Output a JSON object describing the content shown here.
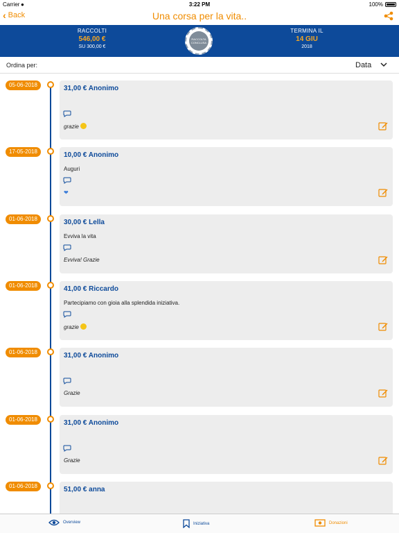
{
  "status": {
    "carrier": "Carrier",
    "time": "3:22 PM",
    "battery": "100%"
  },
  "nav": {
    "back_label": "Back",
    "title": "Una corsa per la vita.."
  },
  "header": {
    "raised_label": "RACCOLTI",
    "raised_value": "546,00 €",
    "goal_text": "SU 300,00 €",
    "badge_text": "RACCOLTA CONCLUSA",
    "ends_label": "TERMINA IL",
    "ends_value": "14 GIU",
    "ends_year": "2018"
  },
  "sort": {
    "label": "Ordina per:",
    "value": "Data"
  },
  "entries": [
    {
      "date": "05-06-2018",
      "amount": "31,00 € Anonimo",
      "message": "",
      "reply": "grazie",
      "emoji": "smile"
    },
    {
      "date": "17-05-2018",
      "amount": "10,00 € Anonimo",
      "message": "Auguri",
      "reply": "",
      "emoji": "heart"
    },
    {
      "date": "01-06-2018",
      "amount": "30,00 € Lella",
      "message": "Evviva la vita",
      "reply": "Evviva! Grazie",
      "emoji": ""
    },
    {
      "date": "01-06-2018",
      "amount": "41,00 € Riccardo",
      "message": "Partecipiamo con gioia alla splendida iniziativa.",
      "reply": "grazie",
      "emoji": "smile"
    },
    {
      "date": "01-06-2018",
      "amount": "31,00 € Anonimo",
      "message": "",
      "reply": "Grazie",
      "emoji": ""
    },
    {
      "date": "01-06-2018",
      "amount": "31,00 € Anonimo",
      "message": "",
      "reply": "Grazie",
      "emoji": ""
    },
    {
      "date": "01-06-2018",
      "amount": "51,00 € anna",
      "message": "",
      "reply": "",
      "emoji": ""
    }
  ],
  "tabs": [
    {
      "label": "Overview",
      "icon": "eye-icon"
    },
    {
      "label": "Iniziativa",
      "icon": "bookmark-icon"
    },
    {
      "label": "Donazioni",
      "icon": "money-icon"
    }
  ],
  "colors": {
    "accent": "#f08c00",
    "primary": "#0d4a9a",
    "card": "#ededed"
  }
}
